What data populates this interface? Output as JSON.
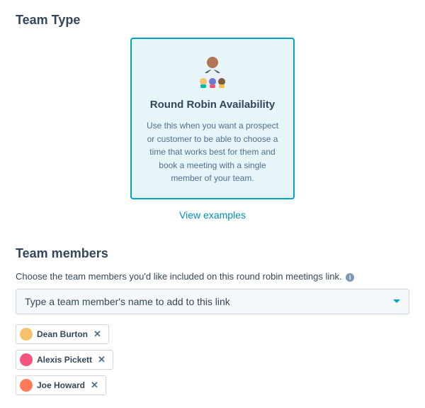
{
  "teamType": {
    "sectionTitle": "Team Type",
    "card": {
      "title": "Round Robin Availability",
      "description": "Use this when you want a prospect or customer to be able to choose a time that works best for them and book a meeting with a single member of your team."
    },
    "viewExamplesLabel": "View examples"
  },
  "teamMembers": {
    "sectionTitle": "Team members",
    "subtext": "Choose the team members you'd like included on this round robin meetings link.",
    "selectPlaceholder": "Type a team member's name to add to this link",
    "members": [
      {
        "name": "Dean Burton",
        "avatarColor": "#f5c26b"
      },
      {
        "name": "Alexis Pickett",
        "avatarColor": "#f2547d"
      },
      {
        "name": "Joe Howard",
        "avatarColor": "#ff7a59"
      }
    ]
  },
  "colors": {
    "accent": "#00a4bd",
    "cardBg": "#e5f5f8",
    "linkTeal": "#0091ae"
  }
}
